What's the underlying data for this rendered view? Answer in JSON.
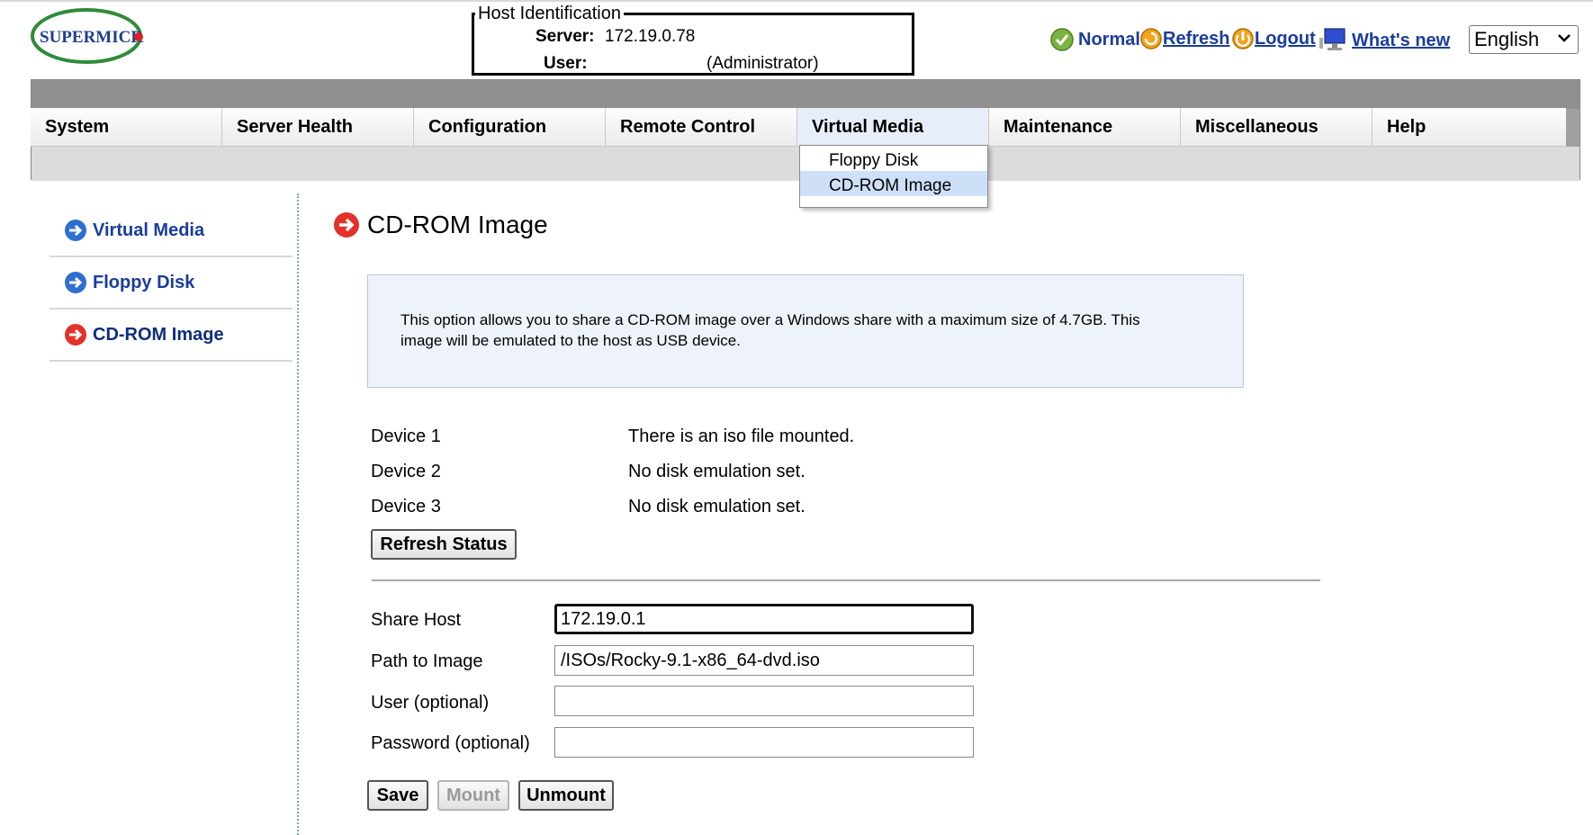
{
  "header": {
    "host_title": "Host Identification",
    "server_label": "Server:",
    "server_value": "172.19.0.78",
    "user_label": "User:",
    "user_value": "(Administrator)",
    "status_label": "Normal",
    "refresh_label": "Refresh",
    "logout_label": "Logout",
    "whats_new_label": "What's new",
    "language": "English"
  },
  "nav": {
    "tabs": [
      {
        "label": "System"
      },
      {
        "label": "Server Health"
      },
      {
        "label": "Configuration"
      },
      {
        "label": "Remote Control"
      },
      {
        "label": "Virtual Media"
      },
      {
        "label": "Maintenance"
      },
      {
        "label": "Miscellaneous"
      },
      {
        "label": "Help"
      }
    ],
    "dropdown": [
      {
        "label": "Floppy Disk"
      },
      {
        "label": "CD-ROM Image"
      }
    ]
  },
  "sidebar": {
    "items": [
      {
        "label": "Virtual Media"
      },
      {
        "label": "Floppy Disk"
      },
      {
        "label": "CD-ROM Image"
      }
    ]
  },
  "main": {
    "title": "CD-ROM Image",
    "info_line1": "This option allows you to share a CD-ROM image over a Windows share with a maximum size of 4.7GB. This",
    "info_line2": "image will be emulated to the host as USB device.",
    "devices": [
      {
        "label": "Device 1",
        "status": "There is an iso file mounted."
      },
      {
        "label": "Device 2",
        "status": "No disk emulation set."
      },
      {
        "label": "Device 3",
        "status": "No disk emulation set."
      }
    ],
    "refresh_status_button": "Refresh Status",
    "form": {
      "share_host_label": "Share Host",
      "share_host_value": "172.19.0.1",
      "path_label": "Path to Image",
      "path_value": "/ISOs/Rocky-9.1-x86_64-dvd.iso",
      "user_label": "User (optional)",
      "user_value": "",
      "password_label": "Password (optional)",
      "password_value": ""
    },
    "buttons": {
      "save": "Save",
      "mount": "Mount",
      "unmount": "Unmount"
    }
  },
  "colors": {
    "link_blue": "#1a3d9c",
    "nav_active": "#e7eef9",
    "dropdown_selected": "#cde0f7",
    "arrow_blue": "#2f6fd0",
    "arrow_red": "#e2322b"
  }
}
